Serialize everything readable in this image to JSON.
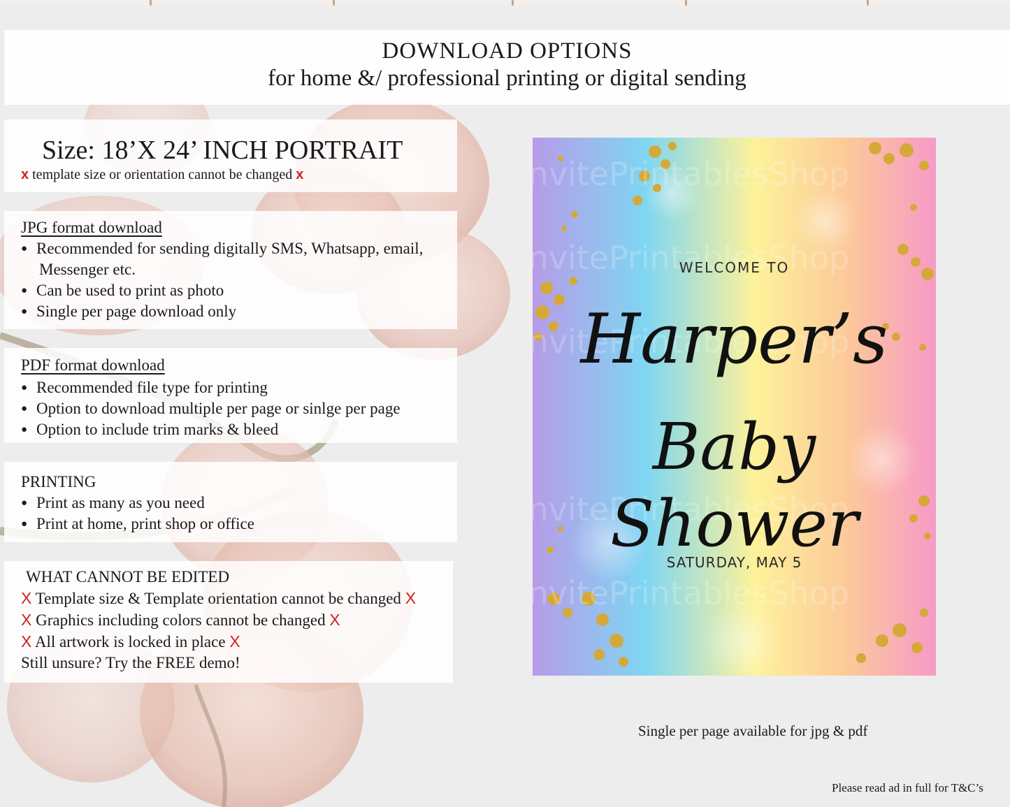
{
  "header": {
    "title": "DOWNLOAD OPTIONS",
    "subtitle": "for home &/ professional printing or digital sending"
  },
  "size_panel": {
    "title": "Size: 18’X 24’ INCH PORTRAIT",
    "note_mark": "x",
    "note": "template size or orientation cannot be changed"
  },
  "jpg_panel": {
    "title": "JPG format download",
    "items": [
      "Recommended for sending digitally SMS, Whatsapp, email,",
      "Can be used to print as photo",
      "Single per page download only"
    ],
    "item0_cont": "Messenger etc."
  },
  "pdf_panel": {
    "title": "PDF format download",
    "items": [
      "Recommended file type for printing",
      "Option to download multiple per page or sinlge per page",
      "Option to include trim marks & bleed"
    ]
  },
  "printing_panel": {
    "title": "PRINTING",
    "items": [
      "Print as many as you need",
      "Print at home, print shop or office"
    ]
  },
  "edit_panel": {
    "title": "WHAT CANNOT BE EDITED",
    "mark": "X",
    "items": [
      "Template size & Template orientation cannot be changed",
      "Graphics including colors cannot be changed",
      "All artwork is locked in place"
    ],
    "closing": "Still unsure? Try the FREE demo!"
  },
  "poster": {
    "welcome": "WELCOME TO",
    "name": "Harper’s",
    "event": "Baby Shower",
    "date": "SATURDAY, MAY 5",
    "watermark": "InvitePrintablesShop",
    "colors": {
      "purple": "#b79be8",
      "blue": "#7fd6f2",
      "yellow": "#fdf29a",
      "pink": "#f79ac8",
      "gold": "#d4a93a"
    }
  },
  "caption": "Single per page available for jpg & pdf",
  "footnote": "Please read ad in full for T&C’s"
}
